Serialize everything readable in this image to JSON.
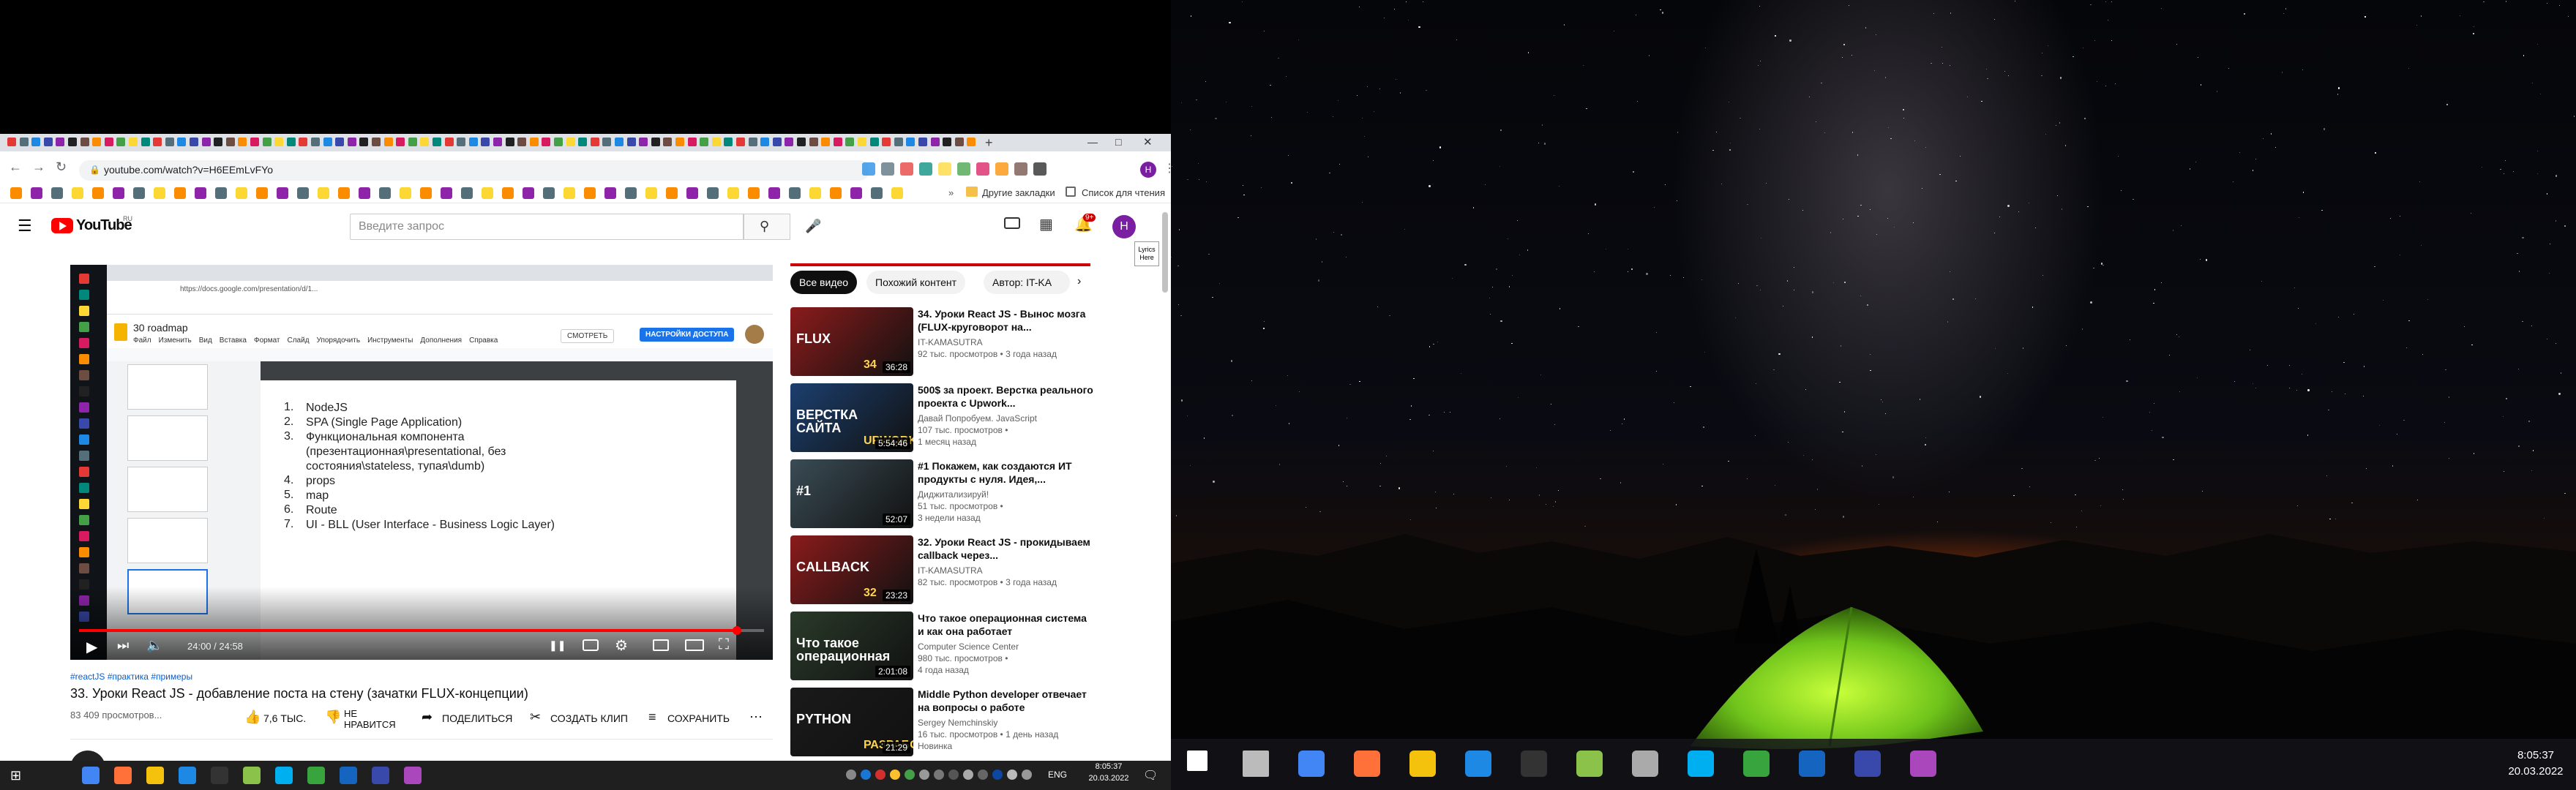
{
  "browser": {
    "url": "youtube.com/watch?v=H6EEmLvFYo",
    "bookmarks_other": "Другие закладки",
    "reading_list": "Список для чтения"
  },
  "youtube": {
    "logo_text": "YouTube",
    "region": "RU",
    "search_placeholder": "Введите запрос",
    "notif_count": "9+",
    "avatar_letter": "H",
    "side_label": "Lyrics Here"
  },
  "player": {
    "time": "24:00 / 24:58",
    "progress_fraction": 0.96,
    "doc_title": "30 roadmap",
    "doc_menu": [
      "Файл",
      "Изменить",
      "Вид",
      "Вставка",
      "Формат",
      "Слайд",
      "Упорядочить",
      "Инструменты",
      "Дополнения",
      "Справка"
    ],
    "doc_watch_btn": "СМОТРЕТЬ",
    "doc_share_btn": "НАСТРОЙКИ ДОСТУПА",
    "inner_url": "https://docs.google.com/presentation/d/1...",
    "slide_items": [
      {
        "n": "1.",
        "t": "NodeJS"
      },
      {
        "n": "2.",
        "t": "SPA (Single Page Application)"
      },
      {
        "n": "3.",
        "t": "Функциональная компонента (презентационная\\presentational, без состояния\\stateless, тупая\\dumb)"
      },
      {
        "n": "4.",
        "t": "props"
      },
      {
        "n": "5.",
        "t": "map"
      },
      {
        "n": "6.",
        "t": "Route"
      },
      {
        "n": "7.",
        "t": "UI - BLL (User Interface - Business Logic Layer)"
      }
    ]
  },
  "video": {
    "hashtags": "#reactJS #практика #примеры",
    "title": "33. Уроки React JS - добавление поста на стену (зачатки FLUX-концепции)",
    "views": "83 409 просмотров...",
    "likes": "7,6 ТЫС.",
    "dislike": "НЕ НРАВИТСЯ",
    "share": "ПОДЕЛИТЬСЯ",
    "clip": "СОЗДАТЬ КЛИП",
    "save": "СОХРАНИТЬ"
  },
  "chips": [
    "Все видео",
    "Похожий контент",
    "Автор: IT-KA"
  ],
  "related": [
    {
      "title": "34. Уроки React JS - Вынос мозга (FLUX-круговорот на...",
      "channel": "IT-KAMASUTRA",
      "stats": "92 тыс. просмотров • 3 года назад",
      "extra": "",
      "duration": "36:28",
      "thumb_text": "FLUX",
      "thumb_num": "34",
      "color": "#8b1b1b"
    },
    {
      "title": "500$ за проект. Верстка реального проекта с Upwork...",
      "channel": "Давай Попробуем. JavaScript",
      "stats": "107 тыс. просмотров •",
      "extra": "1 месяц назад",
      "duration": "5:54:46",
      "thumb_text": "ВЕРСТКА САЙТА",
      "thumb_num": "UPWORK",
      "color": "#1c3f6e"
    },
    {
      "title": "#1 Покажем, как создаются ИТ продукты с нуля. Идея,...",
      "channel": "Диджитализируй!",
      "stats": "51 тыс. просмотров •",
      "extra": "3 недели назад",
      "duration": "52:07",
      "thumb_text": "#1",
      "thumb_num": "",
      "color": "#3a4c55"
    },
    {
      "title": "32. Уроки React JS - прокидываем callback через...",
      "channel": "IT-KAMASUTRA",
      "stats": "82 тыс. просмотров • 3 года назад",
      "extra": "",
      "duration": "23:23",
      "thumb_text": "CALLBACK",
      "thumb_num": "32",
      "color": "#8b1b1b"
    },
    {
      "title": "Что такое операционная система и как она работает",
      "channel": "Computer Science Center",
      "stats": "980 тыс. просмотров •",
      "extra": "4 года назад",
      "duration": "2:01:08",
      "thumb_text": "Что такое операционная система",
      "thumb_num": "",
      "color": "#2a3a2a"
    },
    {
      "title": "Middle Python developer отвечает на вопросы о работе",
      "channel": "Sergey Nemchinskiy",
      "stats": "16 тыс. просмотров • 1 день назад",
      "extra": "Новинка",
      "duration": "21:29",
      "thumb_text": "PYTHON",
      "thumb_num": "РАЗРАБОТЧИК",
      "color": "#1a1a1a"
    }
  ],
  "taskbar_left": {
    "lang": "ENG",
    "time": "8:05:37",
    "date": "20.03.2022"
  },
  "taskbar_right": {
    "time": "8:05:37",
    "date": "20.03.2022"
  }
}
